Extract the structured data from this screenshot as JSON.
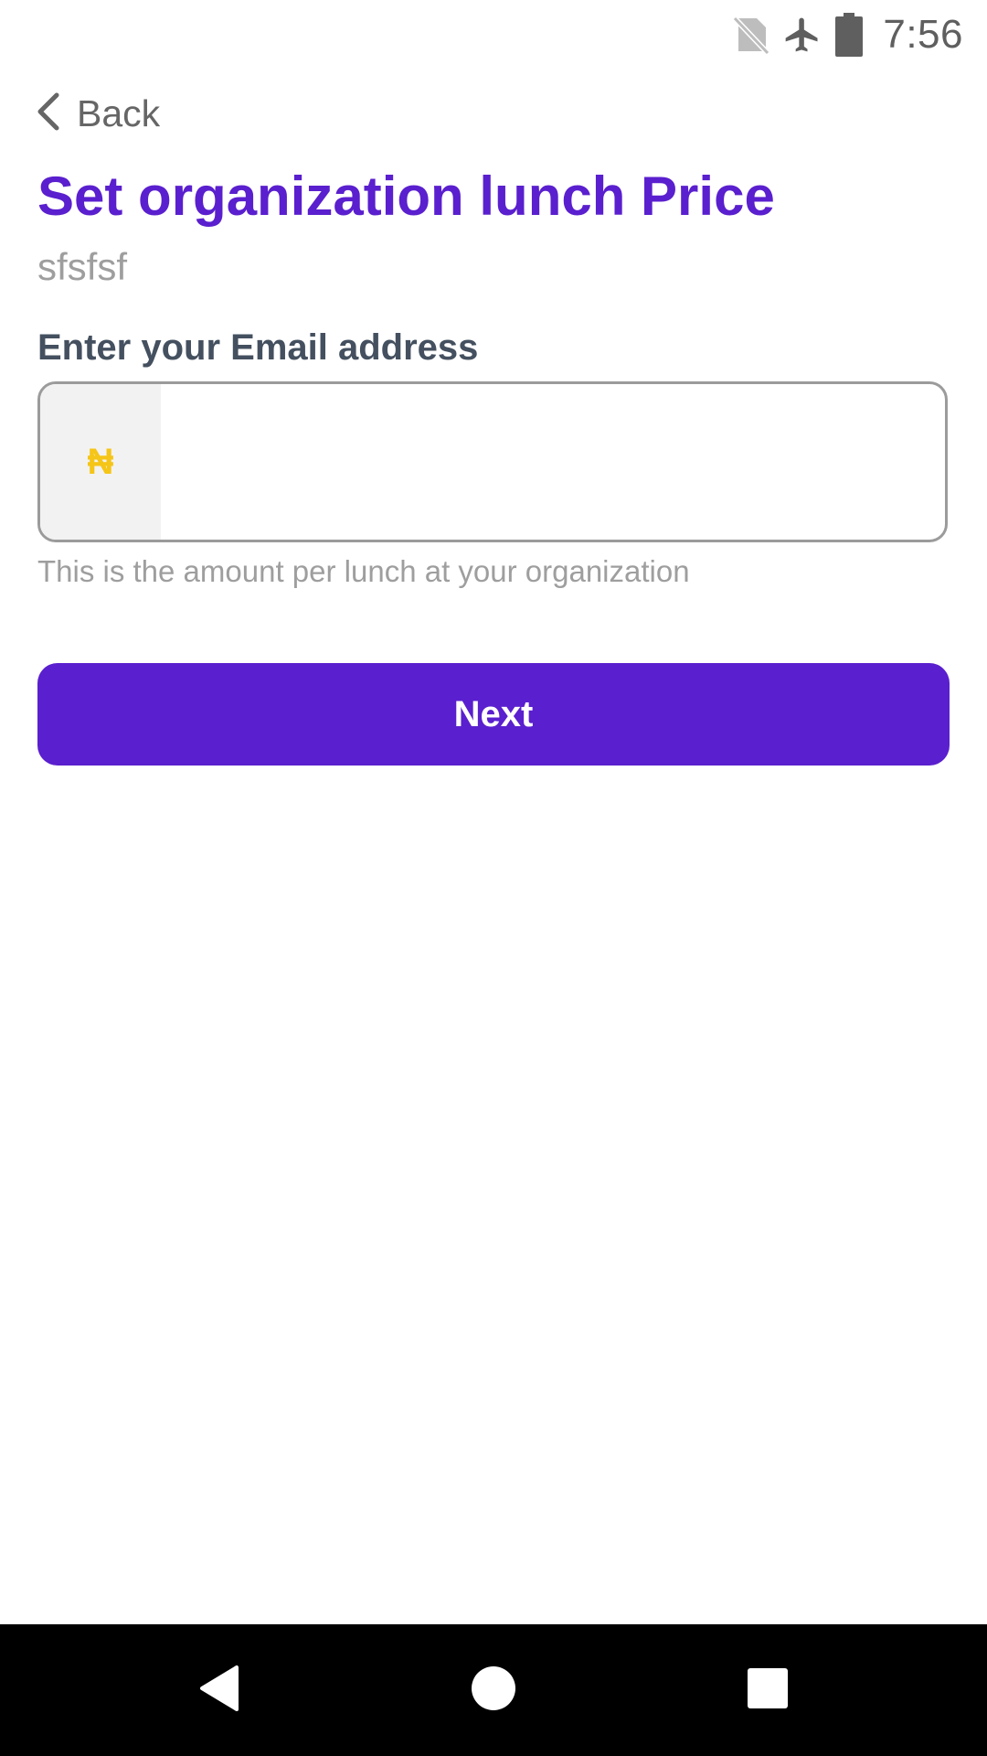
{
  "status_bar": {
    "time": "7:56",
    "icons": [
      "no-sim-icon",
      "airplane-mode-icon",
      "battery-icon"
    ]
  },
  "header": {
    "back_label": "Back"
  },
  "page": {
    "title": "Set organization lunch Price",
    "subtitle": "sfsfsf"
  },
  "form": {
    "label": "Enter your Email address",
    "currency_symbol": "₦",
    "amount_value": "",
    "helper_text": "This is the amount per lunch at your organization"
  },
  "actions": {
    "next_label": "Next"
  },
  "nav_bar": {
    "buttons": [
      "back-triangle-icon",
      "home-circle-icon",
      "recents-square-icon"
    ]
  },
  "colors": {
    "accent": "#5a1fce",
    "currency": "#f5c518",
    "label": "#44505f",
    "muted": "#9e9e9e"
  }
}
